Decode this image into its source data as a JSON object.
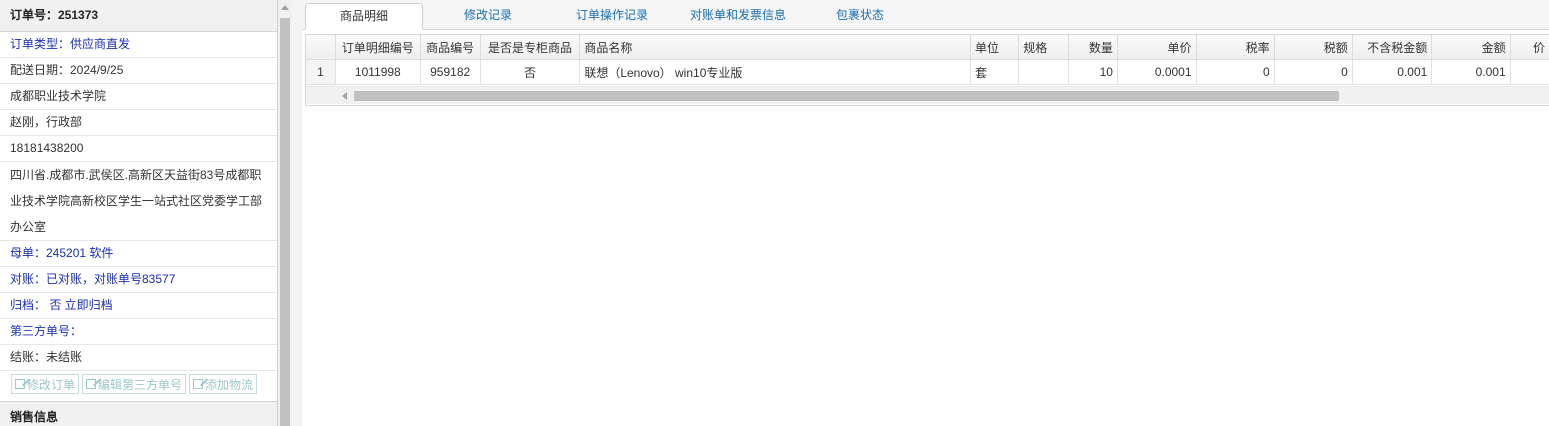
{
  "left": {
    "order_header": "订单号：251373",
    "order_type": "订单类型：供应商直发",
    "delivery_date": "配送日期：2024/9/25",
    "customer_name": "成都职业技术学院",
    "contact": "赵刚，行政部",
    "phone": "18181438200",
    "address_line1": "四川省.成都市.武侯区.高新区天益街83号成都职",
    "address_line2": "业技术学院高新校区学生一站式社区党委学工部",
    "address_line3": "办公室",
    "parent_order": "母单：245201 软件",
    "reconcile": "对账：已对账，对账单号83577",
    "archive": "归档： 否 立即归档",
    "third_party": "第三方单号：",
    "settlement": "结账：未结账",
    "buttons": {
      "edit_order": "修改订单",
      "edit_third_party": "编辑第三方单号",
      "add_logistics": "添加物流"
    },
    "sales_info_header": "销售信息"
  },
  "tabs": [
    {
      "label": "商品明细",
      "active": true
    },
    {
      "label": "修改记录",
      "active": false
    },
    {
      "label": "订单操作记录",
      "active": false
    },
    {
      "label": "对账单和发票信息",
      "active": false
    },
    {
      "label": "包裹状态",
      "active": false
    }
  ],
  "table": {
    "columns": [
      "",
      "订单明细编号",
      "商品编号",
      "是否是专柜商品",
      "商品名称",
      "单位",
      "规格",
      "数量",
      "单价",
      "税率",
      "税额",
      "不含税金额",
      "金额",
      "价"
    ],
    "rows": [
      [
        "1",
        "1011998",
        "959182",
        "否",
        "联想（Lenovo） win10专业版",
        "套",
        "",
        "10",
        "0.0001",
        "0",
        "0",
        "0.001",
        "0.001",
        ""
      ]
    ]
  },
  "colors": {
    "link_blue": "#1a2fb5",
    "tab_blue": "#1a6fb0",
    "disabled_button": "#9cc7cb"
  },
  "icons": {
    "button_icon": "edit-icon"
  }
}
